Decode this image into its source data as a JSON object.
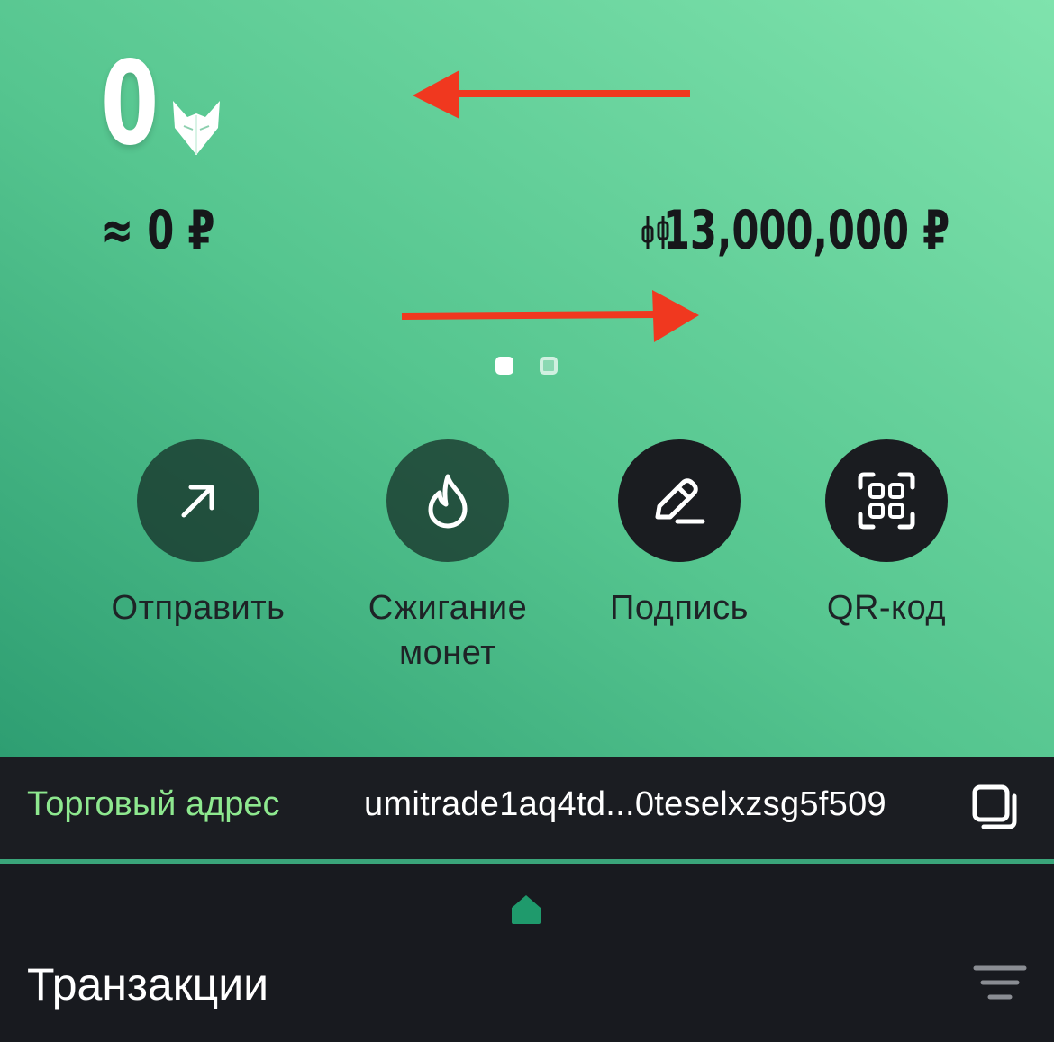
{
  "wallet": {
    "balance": "0",
    "fiat_approx": "≈ 0 ₽",
    "price": "13,000,000 ₽",
    "coin_icon": "fox-icon",
    "price_icon": "candlestick-icon"
  },
  "carousel": {
    "pages": 2,
    "active_page": 1
  },
  "actions": [
    {
      "label": "Отправить",
      "icon": "arrow-up-right-icon"
    },
    {
      "label": "Сжигание монет",
      "icon": "flame-icon"
    },
    {
      "label": "Подпись",
      "icon": "pen-icon"
    },
    {
      "label": "QR-код",
      "icon": "qr-scan-icon"
    }
  ],
  "address": {
    "label": "Торговый адрес",
    "value": "umitrade1aq4td...0teselxzsg5f509",
    "copy_icon": "copy-icon"
  },
  "transactions": {
    "title": "Транзакции",
    "tab_icon": "home-icon",
    "filter_icon": "filter-icon"
  },
  "colors": {
    "accent_green": "#3aa57a",
    "address_label": "#8ee88f",
    "annotation_arrow": "#f0381f",
    "dark_bg": "#181a1f"
  }
}
